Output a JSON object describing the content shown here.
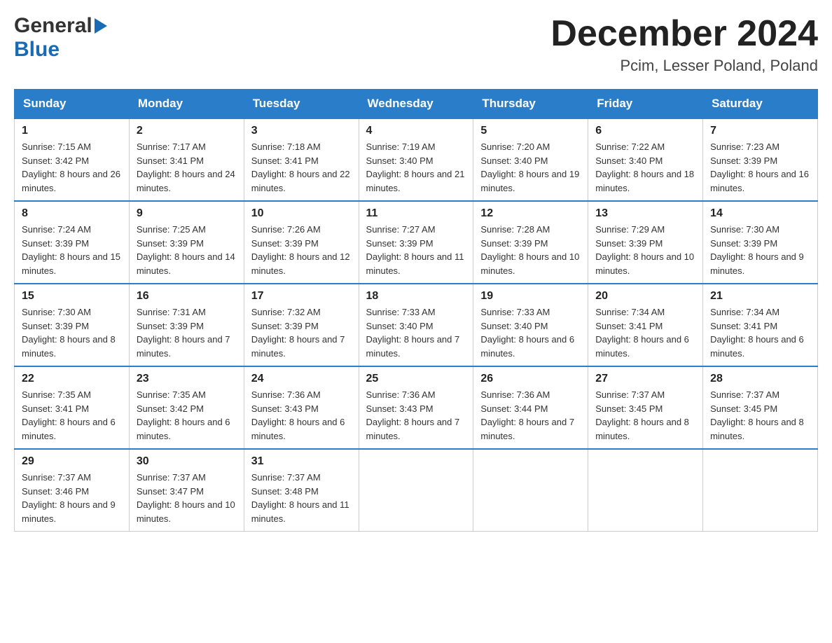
{
  "header": {
    "logo_general": "General",
    "logo_blue": "Blue",
    "month_title": "December 2024",
    "location": "Pcim, Lesser Poland, Poland"
  },
  "days_of_week": [
    "Sunday",
    "Monday",
    "Tuesday",
    "Wednesday",
    "Thursday",
    "Friday",
    "Saturday"
  ],
  "weeks": [
    [
      {
        "day": "1",
        "sunrise": "7:15 AM",
        "sunset": "3:42 PM",
        "daylight": "8 hours and 26 minutes."
      },
      {
        "day": "2",
        "sunrise": "7:17 AM",
        "sunset": "3:41 PM",
        "daylight": "8 hours and 24 minutes."
      },
      {
        "day": "3",
        "sunrise": "7:18 AM",
        "sunset": "3:41 PM",
        "daylight": "8 hours and 22 minutes."
      },
      {
        "day": "4",
        "sunrise": "7:19 AM",
        "sunset": "3:40 PM",
        "daylight": "8 hours and 21 minutes."
      },
      {
        "day": "5",
        "sunrise": "7:20 AM",
        "sunset": "3:40 PM",
        "daylight": "8 hours and 19 minutes."
      },
      {
        "day": "6",
        "sunrise": "7:22 AM",
        "sunset": "3:40 PM",
        "daylight": "8 hours and 18 minutes."
      },
      {
        "day": "7",
        "sunrise": "7:23 AM",
        "sunset": "3:39 PM",
        "daylight": "8 hours and 16 minutes."
      }
    ],
    [
      {
        "day": "8",
        "sunrise": "7:24 AM",
        "sunset": "3:39 PM",
        "daylight": "8 hours and 15 minutes."
      },
      {
        "day": "9",
        "sunrise": "7:25 AM",
        "sunset": "3:39 PM",
        "daylight": "8 hours and 14 minutes."
      },
      {
        "day": "10",
        "sunrise": "7:26 AM",
        "sunset": "3:39 PM",
        "daylight": "8 hours and 12 minutes."
      },
      {
        "day": "11",
        "sunrise": "7:27 AM",
        "sunset": "3:39 PM",
        "daylight": "8 hours and 11 minutes."
      },
      {
        "day": "12",
        "sunrise": "7:28 AM",
        "sunset": "3:39 PM",
        "daylight": "8 hours and 10 minutes."
      },
      {
        "day": "13",
        "sunrise": "7:29 AM",
        "sunset": "3:39 PM",
        "daylight": "8 hours and 10 minutes."
      },
      {
        "day": "14",
        "sunrise": "7:30 AM",
        "sunset": "3:39 PM",
        "daylight": "8 hours and 9 minutes."
      }
    ],
    [
      {
        "day": "15",
        "sunrise": "7:30 AM",
        "sunset": "3:39 PM",
        "daylight": "8 hours and 8 minutes."
      },
      {
        "day": "16",
        "sunrise": "7:31 AM",
        "sunset": "3:39 PM",
        "daylight": "8 hours and 7 minutes."
      },
      {
        "day": "17",
        "sunrise": "7:32 AM",
        "sunset": "3:39 PM",
        "daylight": "8 hours and 7 minutes."
      },
      {
        "day": "18",
        "sunrise": "7:33 AM",
        "sunset": "3:40 PM",
        "daylight": "8 hours and 7 minutes."
      },
      {
        "day": "19",
        "sunrise": "7:33 AM",
        "sunset": "3:40 PM",
        "daylight": "8 hours and 6 minutes."
      },
      {
        "day": "20",
        "sunrise": "7:34 AM",
        "sunset": "3:41 PM",
        "daylight": "8 hours and 6 minutes."
      },
      {
        "day": "21",
        "sunrise": "7:34 AM",
        "sunset": "3:41 PM",
        "daylight": "8 hours and 6 minutes."
      }
    ],
    [
      {
        "day": "22",
        "sunrise": "7:35 AM",
        "sunset": "3:41 PM",
        "daylight": "8 hours and 6 minutes."
      },
      {
        "day": "23",
        "sunrise": "7:35 AM",
        "sunset": "3:42 PM",
        "daylight": "8 hours and 6 minutes."
      },
      {
        "day": "24",
        "sunrise": "7:36 AM",
        "sunset": "3:43 PM",
        "daylight": "8 hours and 6 minutes."
      },
      {
        "day": "25",
        "sunrise": "7:36 AM",
        "sunset": "3:43 PM",
        "daylight": "8 hours and 7 minutes."
      },
      {
        "day": "26",
        "sunrise": "7:36 AM",
        "sunset": "3:44 PM",
        "daylight": "8 hours and 7 minutes."
      },
      {
        "day": "27",
        "sunrise": "7:37 AM",
        "sunset": "3:45 PM",
        "daylight": "8 hours and 8 minutes."
      },
      {
        "day": "28",
        "sunrise": "7:37 AM",
        "sunset": "3:45 PM",
        "daylight": "8 hours and 8 minutes."
      }
    ],
    [
      {
        "day": "29",
        "sunrise": "7:37 AM",
        "sunset": "3:46 PM",
        "daylight": "8 hours and 9 minutes."
      },
      {
        "day": "30",
        "sunrise": "7:37 AM",
        "sunset": "3:47 PM",
        "daylight": "8 hours and 10 minutes."
      },
      {
        "day": "31",
        "sunrise": "7:37 AM",
        "sunset": "3:48 PM",
        "daylight": "8 hours and 11 minutes."
      },
      null,
      null,
      null,
      null
    ]
  ],
  "labels": {
    "sunrise": "Sunrise: ",
    "sunset": "Sunset: ",
    "daylight": "Daylight: "
  }
}
